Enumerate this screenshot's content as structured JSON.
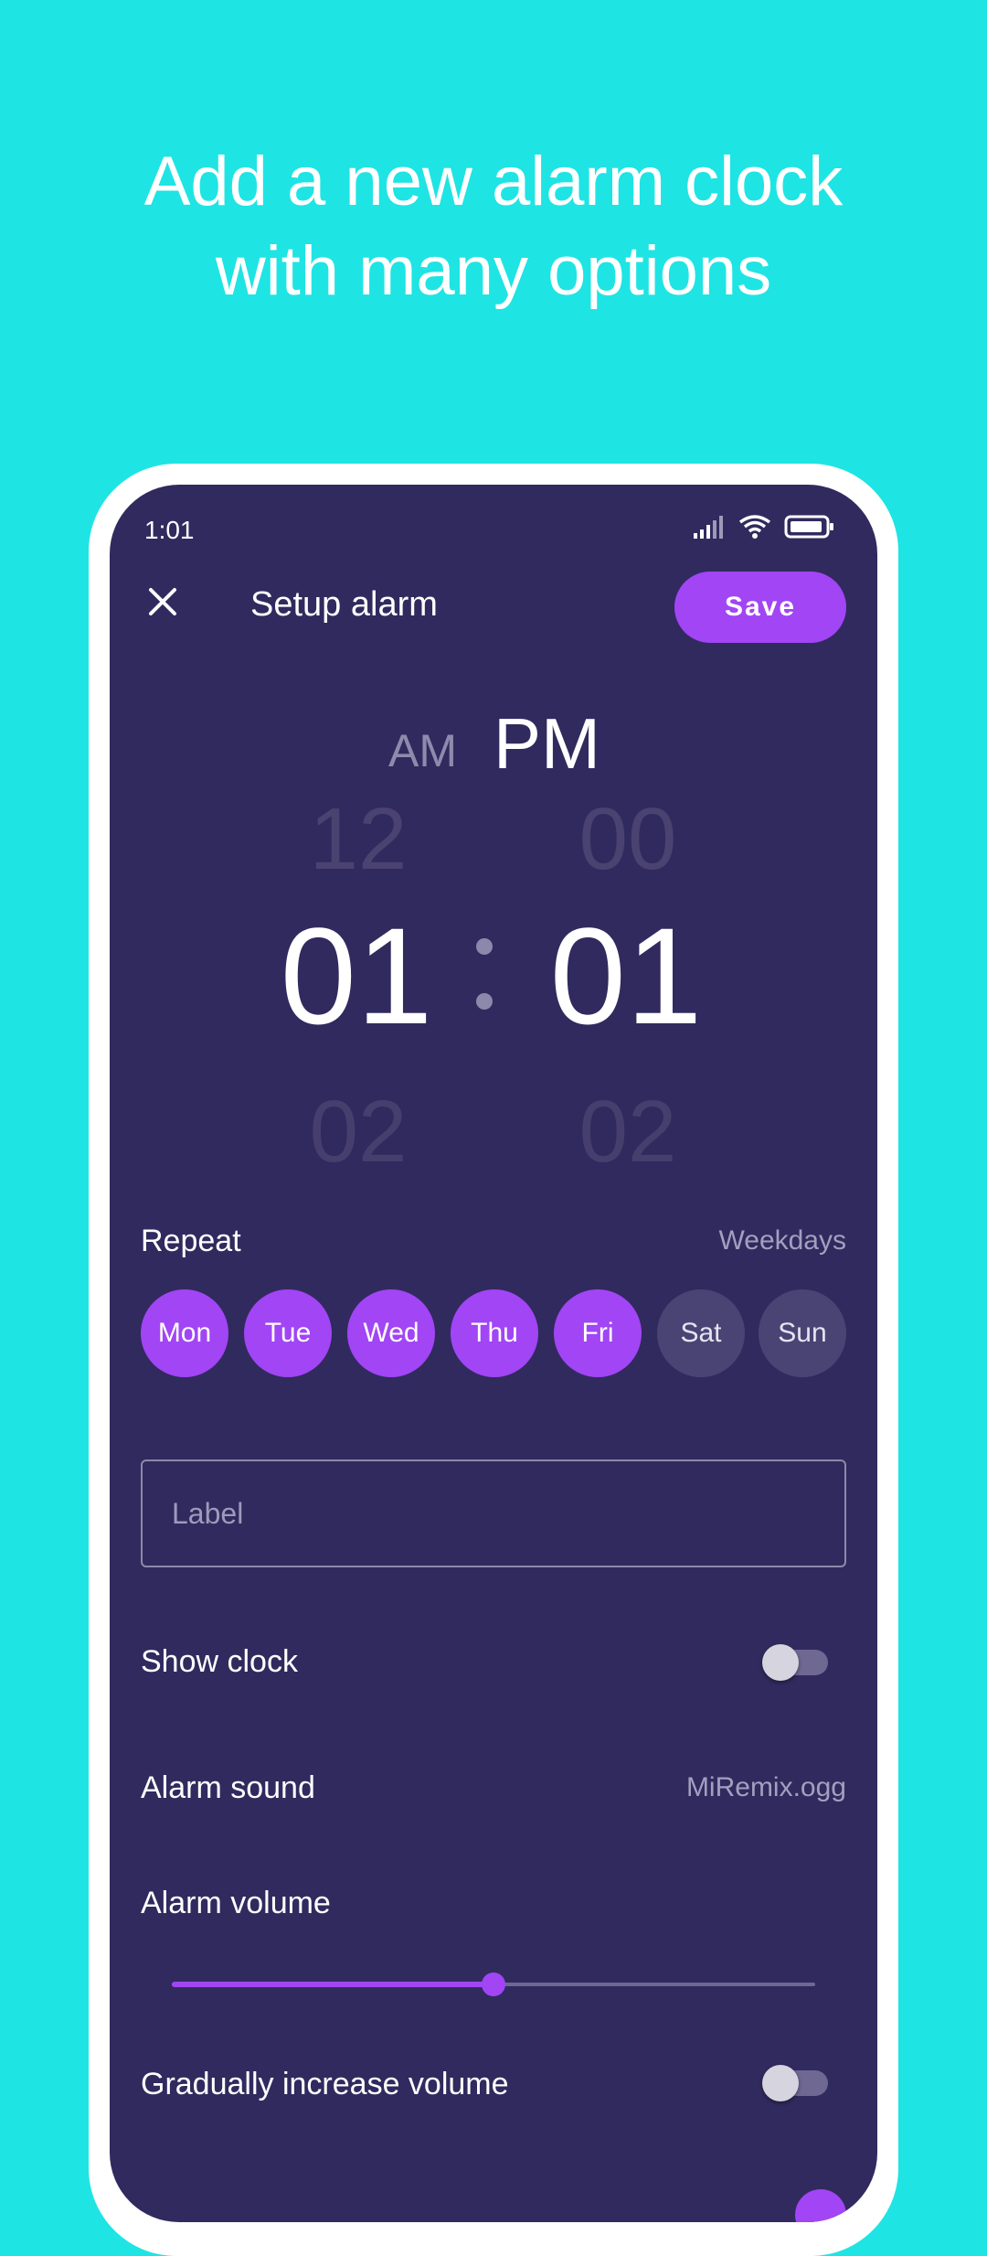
{
  "promo": {
    "line1": "Add a new alarm clock",
    "line2": "with many options"
  },
  "status_bar": {
    "time": "1:01",
    "icons": [
      "signal-icon",
      "wifi-icon",
      "battery-icon"
    ]
  },
  "toolbar": {
    "close_icon": "close-icon",
    "title": "Setup alarm",
    "save_label": "Save"
  },
  "time_picker": {
    "am_label": "AM",
    "pm_label": "PM",
    "selected_period": "PM",
    "hour_prev": "12",
    "hour": "01",
    "hour_next": "02",
    "minute_prev": "00",
    "minute": "01",
    "minute_next": "02"
  },
  "repeat": {
    "label": "Repeat",
    "summary": "Weekdays",
    "days": [
      {
        "label": "Mon",
        "selected": true
      },
      {
        "label": "Tue",
        "selected": true
      },
      {
        "label": "Wed",
        "selected": true
      },
      {
        "label": "Thu",
        "selected": true
      },
      {
        "label": "Fri",
        "selected": true
      },
      {
        "label": "Sat",
        "selected": false
      },
      {
        "label": "Sun",
        "selected": false
      }
    ]
  },
  "label_field": {
    "placeholder": "Label",
    "value": ""
  },
  "show_clock": {
    "label": "Show clock",
    "enabled": false
  },
  "alarm_sound": {
    "label": "Alarm sound",
    "value": "MiRemix.ogg"
  },
  "alarm_volume": {
    "label": "Alarm volume",
    "level": 0.5
  },
  "gradual_volume": {
    "label": "Gradually increase volume",
    "enabled": false
  },
  "colors": {
    "background": "#1fe4e4",
    "screen": "#312a5e",
    "accent": "#a145f5",
    "inactive_day": "#4a4474"
  }
}
